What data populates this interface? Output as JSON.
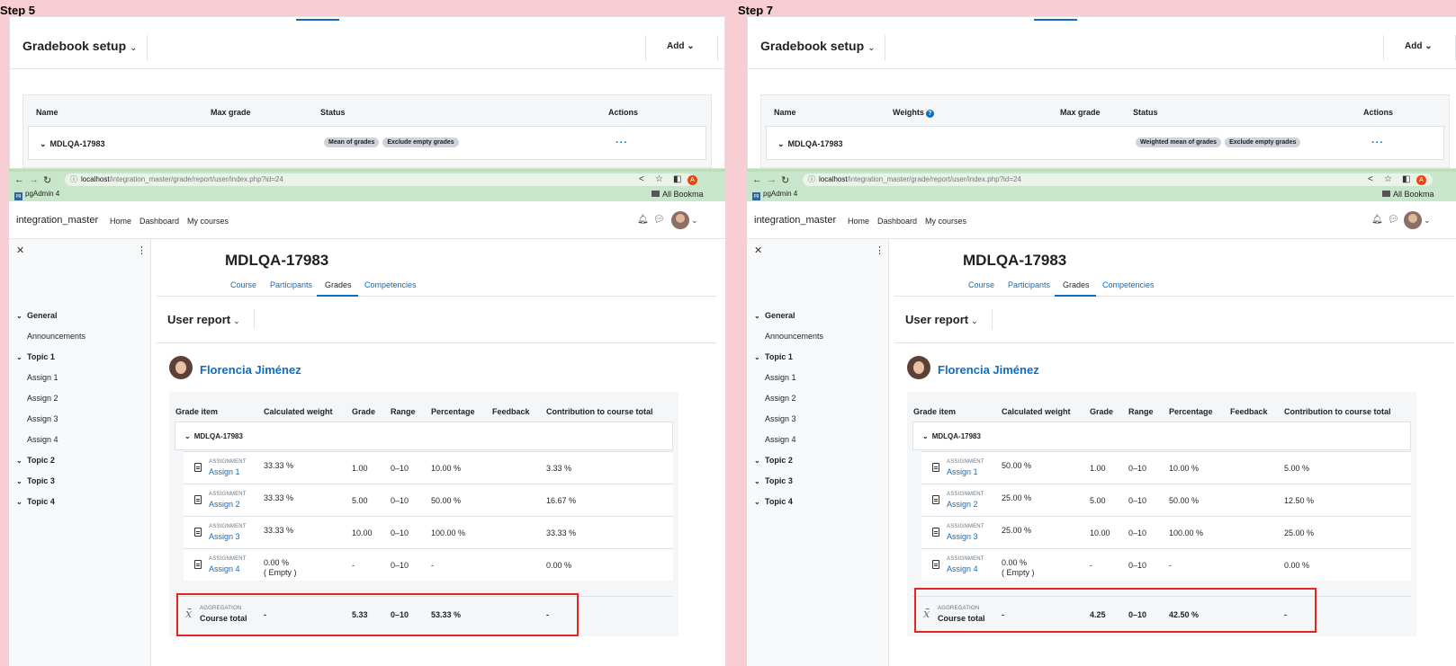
{
  "panels": [
    {
      "step_label": "Step 5",
      "gradebook": {
        "title": "Gradebook setup",
        "add_label": "Add",
        "columns": {
          "name": "Name",
          "weights": "",
          "max_grade": "Max grade",
          "status": "Status",
          "actions": "Actions"
        },
        "category": "MDLQA-17983",
        "badges": [
          "Mean of grades",
          "Exclude empty grades"
        ],
        "actions_glyph": "···"
      },
      "browser": {
        "url_host": "localhost",
        "url_path": "/integration_master/grade/report/user/index.php?id=24",
        "profile_initial": "A",
        "bookmark": "pgAdmin 4",
        "all_bookmarks": "All Bookma"
      },
      "site": {
        "name": "integration_master",
        "nav": [
          "Home",
          "Dashboard",
          "My courses"
        ]
      },
      "drawer": {
        "items": [
          {
            "label": "General",
            "section": true
          },
          {
            "label": "Announcements",
            "section": false
          },
          {
            "label": "Topic 1",
            "section": true
          },
          {
            "label": "Assign 1",
            "section": false
          },
          {
            "label": "Assign 2",
            "section": false
          },
          {
            "label": "Assign 3",
            "section": false
          },
          {
            "label": "Assign 4",
            "section": false
          },
          {
            "label": "Topic 2",
            "section": true
          },
          {
            "label": "Topic 3",
            "section": true
          },
          {
            "label": "Topic 4",
            "section": true
          }
        ]
      },
      "course": {
        "title": "MDLQA-17983",
        "tabs": [
          "Course",
          "Participants",
          "Grades",
          "Competencies"
        ],
        "active_tab": "Grades"
      },
      "report": {
        "title": "User report",
        "user_name": "Florencia Jiménez",
        "columns": [
          "Grade item",
          "Calculated weight",
          "Grade",
          "Range",
          "Percentage",
          "Feedback",
          "Contribution to course total"
        ],
        "category": "MDLQA-17983",
        "rows": [
          {
            "type": "ASSIGNMENT",
            "name": "Assign 1",
            "weight": "33.33 %",
            "weight_note": "",
            "grade": "1.00",
            "range": "0–10",
            "percentage": "10.00 %",
            "feedback": "",
            "contribution": "3.33 %"
          },
          {
            "type": "ASSIGNMENT",
            "name": "Assign 2",
            "weight": "33.33 %",
            "weight_note": "",
            "grade": "5.00",
            "range": "0–10",
            "percentage": "50.00 %",
            "feedback": "",
            "contribution": "16.67 %"
          },
          {
            "type": "ASSIGNMENT",
            "name": "Assign 3",
            "weight": "33.33 %",
            "weight_note": "",
            "grade": "10.00",
            "range": "0–10",
            "percentage": "100.00 %",
            "feedback": "",
            "contribution": "33.33 %"
          },
          {
            "type": "ASSIGNMENT",
            "name": "Assign 4",
            "weight": "0.00 %",
            "weight_note": "( Empty )",
            "grade": "-",
            "range": "0–10",
            "percentage": "-",
            "feedback": "",
            "contribution": "0.00 %"
          }
        ],
        "total": {
          "type": "AGGREGATION",
          "name": "Course total",
          "weight": "-",
          "grade": "5.33",
          "range": "0–10",
          "percentage": "53.33 %",
          "feedback": "",
          "contribution": "-"
        }
      }
    },
    {
      "step_label": "Step 7",
      "gradebook": {
        "title": "Gradebook setup",
        "add_label": "Add",
        "columns": {
          "name": "Name",
          "weights": "Weights",
          "max_grade": "Max grade",
          "status": "Status",
          "actions": "Actions"
        },
        "category": "MDLQA-17983",
        "badges": [
          "Weighted mean of grades",
          "Exclude empty grades"
        ],
        "actions_glyph": "···"
      },
      "browser": {
        "url_host": "localhost",
        "url_path": "/integration_master/grade/report/user/index.php?id=24",
        "profile_initial": "A",
        "bookmark": "pgAdmin 4",
        "all_bookmarks": "All Bookma"
      },
      "site": {
        "name": "integration_master",
        "nav": [
          "Home",
          "Dashboard",
          "My courses"
        ]
      },
      "drawer": {
        "items": [
          {
            "label": "General",
            "section": true
          },
          {
            "label": "Announcements",
            "section": false
          },
          {
            "label": "Topic 1",
            "section": true
          },
          {
            "label": "Assign 1",
            "section": false
          },
          {
            "label": "Assign 2",
            "section": false
          },
          {
            "label": "Assign 3",
            "section": false
          },
          {
            "label": "Assign 4",
            "section": false
          },
          {
            "label": "Topic 2",
            "section": true
          },
          {
            "label": "Topic 3",
            "section": true
          },
          {
            "label": "Topic 4",
            "section": true
          }
        ]
      },
      "course": {
        "title": "MDLQA-17983",
        "tabs": [
          "Course",
          "Participants",
          "Grades",
          "Competencies"
        ],
        "active_tab": "Grades"
      },
      "report": {
        "title": "User report",
        "user_name": "Florencia Jiménez",
        "columns": [
          "Grade item",
          "Calculated weight",
          "Grade",
          "Range",
          "Percentage",
          "Feedback",
          "Contribution to course total"
        ],
        "category": "MDLQA-17983",
        "rows": [
          {
            "type": "ASSIGNMENT",
            "name": "Assign 1",
            "weight": "50.00 %",
            "weight_note": "",
            "grade": "1.00",
            "range": "0–10",
            "percentage": "10.00 %",
            "feedback": "",
            "contribution": "5.00 %"
          },
          {
            "type": "ASSIGNMENT",
            "name": "Assign 2",
            "weight": "25.00 %",
            "weight_note": "",
            "grade": "5.00",
            "range": "0–10",
            "percentage": "50.00 %",
            "feedback": "",
            "contribution": "12.50 %"
          },
          {
            "type": "ASSIGNMENT",
            "name": "Assign 3",
            "weight": "25.00 %",
            "weight_note": "",
            "grade": "10.00",
            "range": "0–10",
            "percentage": "100.00 %",
            "feedback": "",
            "contribution": "25.00 %"
          },
          {
            "type": "ASSIGNMENT",
            "name": "Assign 4",
            "weight": "0.00 %",
            "weight_note": "( Empty )",
            "grade": "-",
            "range": "0–10",
            "percentage": "-",
            "feedback": "",
            "contribution": "0.00 %"
          }
        ],
        "total": {
          "type": "AGGREGATION",
          "name": "Course total",
          "weight": "-",
          "grade": "4.25",
          "range": "0–10",
          "percentage": "42.50 %",
          "feedback": "",
          "contribution": "-"
        }
      }
    }
  ],
  "colors": {
    "link": "#0f6cbf",
    "highlight": "#e52424",
    "backdrop": "#f8cdd3",
    "browser_chrome": "#c8e6c9"
  }
}
